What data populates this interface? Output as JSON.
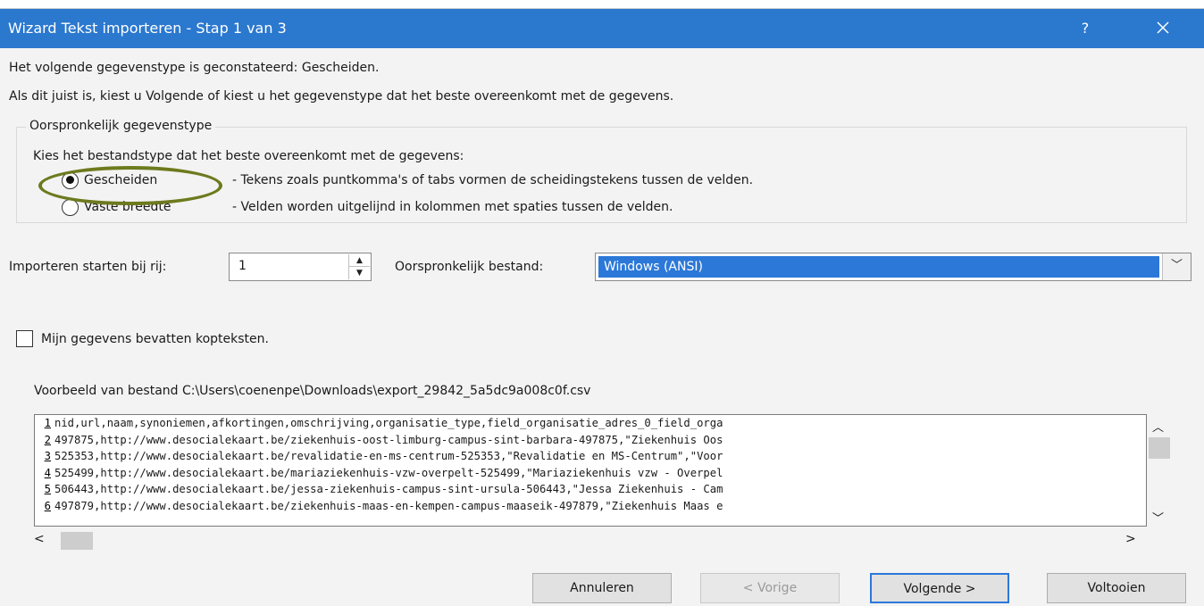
{
  "window": {
    "title": "Wizard Tekst importeren - Stap 1 van 3",
    "help_label": "?",
    "close_label": "✕"
  },
  "intro": {
    "line1": "Het volgende gegevenstype is geconstateerd: Gescheiden.",
    "line2": "Als dit juist is, kiest u Volgende of kiest u het gegevenstype dat het beste overeenkomt met de gegevens."
  },
  "group": {
    "legend": "Oorspronkelijk gegevenstype",
    "prompt": "Kies het bestandstype dat het beste overeenkomt met de gegevens:",
    "options": [
      {
        "label": "Gescheiden",
        "description": "- Tekens zoals puntkomma's of tabs vormen de scheidingstekens tussen de velden.",
        "checked": true
      },
      {
        "label": "Vaste breedte",
        "description": "- Velden worden uitgelijnd in kolommen met spaties tussen de velden.",
        "checked": false
      }
    ]
  },
  "import_start": {
    "label": "Importeren starten bij rij:",
    "value": "1"
  },
  "origin": {
    "label": "Oorspronkelijk bestand:",
    "value": "Windows (ANSI)"
  },
  "headers_checkbox": {
    "label": "Mijn gegevens bevatten kopteksten.",
    "checked": false
  },
  "preview": {
    "label": "Voorbeeld van bestand C:\\Users\\coenenpe\\Downloads\\export_29842_5a5dc9a008c0f.csv",
    "rows": [
      {
        "num": "1",
        "text": "nid,url,naam,synoniemen,afkortingen,omschrijving,organisatie_type,field_organisatie_adres_0_field_orga"
      },
      {
        "num": "2",
        "text": "497875,http://www.desocialekaart.be/ziekenhuis-oost-limburg-campus-sint-barbara-497875,\"Ziekenhuis Oos"
      },
      {
        "num": "3",
        "text": "525353,http://www.desocialekaart.be/revalidatie-en-ms-centrum-525353,\"Revalidatie en MS-Centrum\",\"Voor"
      },
      {
        "num": "4",
        "text": "525499,http://www.desocialekaart.be/mariaziekenhuis-vzw-overpelt-525499,\"Mariaziekenhuis vzw - Overpel"
      },
      {
        "num": "5",
        "text": "506443,http://www.desocialekaart.be/jessa-ziekenhuis-campus-sint-ursula-506443,\"Jessa Ziekenhuis - Cam"
      },
      {
        "num": "6",
        "text": "497879,http://www.desocialekaart.be/ziekenhuis-maas-en-kempen-campus-maaseik-497879,\"Ziekenhuis Maas e"
      }
    ]
  },
  "buttons": {
    "cancel": "Annuleren",
    "back": "< Vorige",
    "next": "Volgende >",
    "finish": "Voltooien"
  },
  "colors": {
    "titlebar": "#2b78cf",
    "selection": "#2b78d8",
    "highlight_ellipse": "#6d7a1e"
  }
}
